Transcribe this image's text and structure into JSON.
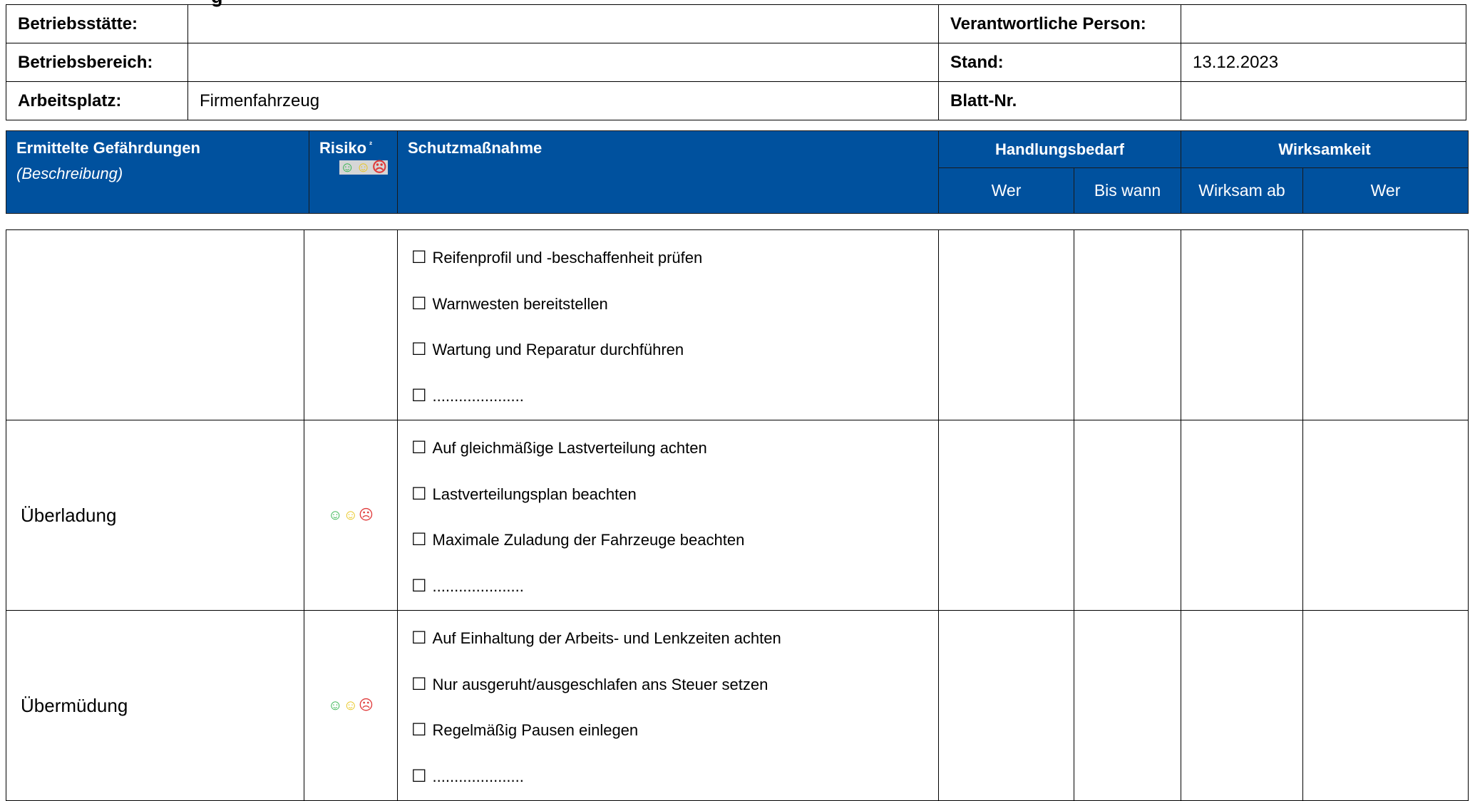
{
  "title_fragment": "g",
  "info": {
    "betriebsstaette_label": "Betriebsstätte:",
    "betriebsstaette_value": "",
    "verantwortliche_label": "Verantwortliche Person:",
    "verantwortliche_value": "",
    "betriebsbereich_label": "Betriebsbereich:",
    "betriebsbereich_value": "",
    "stand_label": "Stand:",
    "stand_value": "13.12.2023",
    "arbeitsplatz_label": "Arbeitsplatz:",
    "arbeitsplatz_value": "Firmenfahrzeug",
    "blatt_label": "Blatt-Nr.",
    "blatt_value": ""
  },
  "header": {
    "gefaehrdungen": "Ermittelte Gefährdungen",
    "beschreibung": "(Beschreibung)",
    "risiko": "Risiko",
    "risiko_sup": "²",
    "schutzmassnahme": "Schutzmaßnahme",
    "handlungsbedarf": "Handlungsbedarf",
    "wirksamkeit": "Wirksamkeit",
    "wer1": "Wer",
    "bis_wann": "Bis wann",
    "wirksam_ab": "Wirksam ab",
    "wer2": "Wer"
  },
  "smiley_glyphs": {
    "good": "☺",
    "neutral": "☺",
    "bad": "☹"
  },
  "checkbox_glyph": "☐",
  "rows": [
    {
      "gefaehrdung": "",
      "show_risk": false,
      "measures": [
        "Reifenprofil und -beschaffenheit prüfen",
        "Warnwesten bereitstellen",
        "Wartung und Reparatur durchführen",
        "....................."
      ]
    },
    {
      "gefaehrdung": "Überladung",
      "show_risk": true,
      "measures": [
        "Auf gleichmäßige Lastverteilung achten",
        "Lastverteilungsplan beachten",
        "Maximale Zuladung der Fahrzeuge beachten",
        "....................."
      ]
    },
    {
      "gefaehrdung": "Übermüdung",
      "show_risk": true,
      "measures": [
        "Auf Einhaltung der Arbeits- und Lenkzeiten achten",
        "Nur ausgeruht/ausgeschlafen ans Steuer setzen",
        "Regelmäßig Pausen einlegen",
        "....................."
      ]
    }
  ],
  "colors": {
    "header_bg": "#00519e",
    "smiley_green": "#2fb24a",
    "smiley_yellow": "#e8c418",
    "smiley_red": "#e03a3a"
  }
}
